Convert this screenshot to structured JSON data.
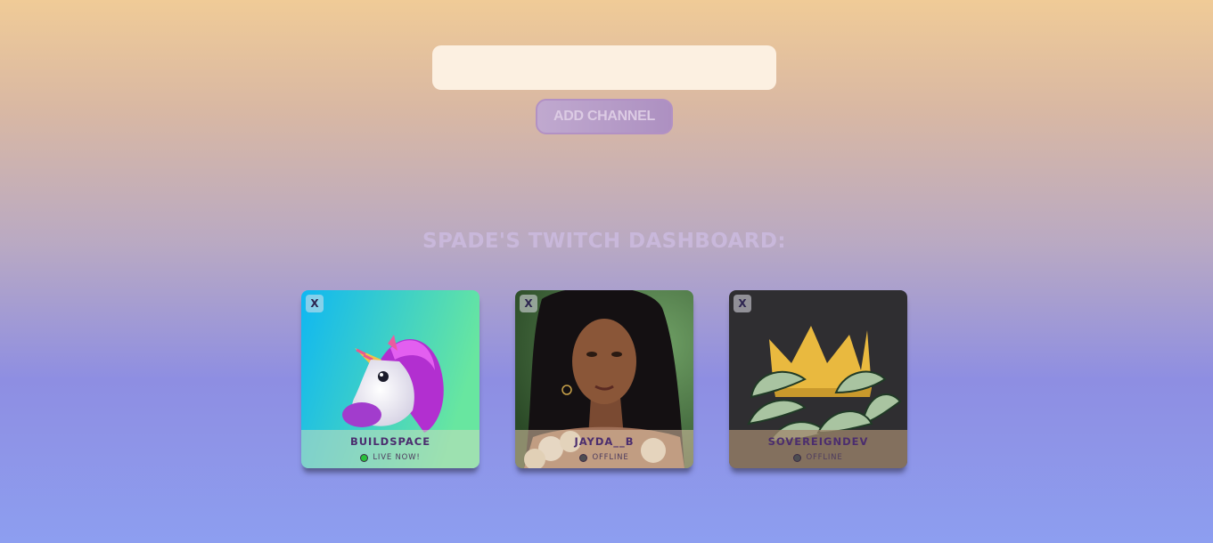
{
  "search": {
    "value": "",
    "placeholder": ""
  },
  "add_button": {
    "label": "ADD CHANNEL"
  },
  "dashboard": {
    "title": "SPADE'S TWITCH DASHBOARD:"
  },
  "channels": [
    {
      "name": "BUILDSPACE",
      "status": "LIVE NOW!",
      "live": true,
      "close_label": "X",
      "avatar": "unicode-emoji"
    },
    {
      "name": "JAYDA__B",
      "status": "OFFLINE",
      "live": false,
      "close_label": "X",
      "avatar": "woman-portrait"
    },
    {
      "name": "SOVEREIGNDEV",
      "status": "OFFLINE",
      "live": false,
      "close_label": "X",
      "avatar": "crown-with-leaves"
    }
  ],
  "colors": {
    "live": "#29c03b",
    "offline": "#4d4d52",
    "title": "#c9b8db",
    "name": "#4b2d6e"
  }
}
